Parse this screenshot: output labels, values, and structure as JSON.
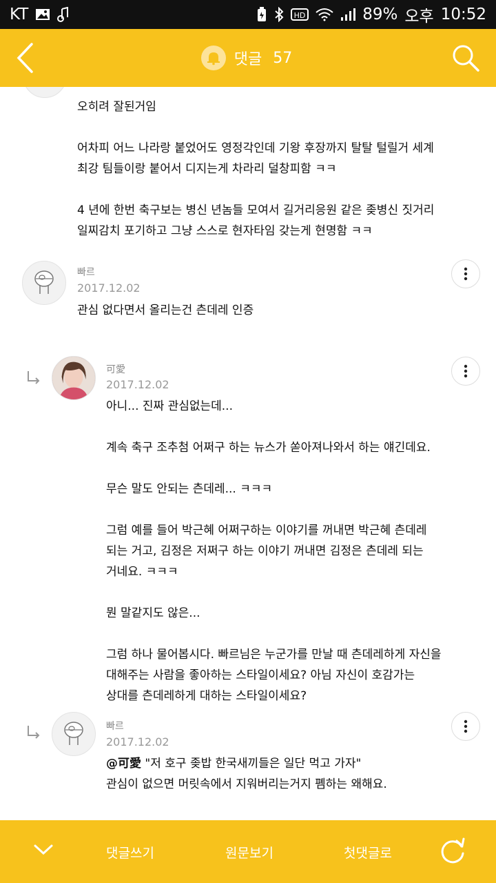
{
  "status_bar": {
    "carrier": "KT",
    "battery": "89%",
    "ampm": "오후",
    "time": "10:52",
    "icons": [
      "image-icon",
      "music-icon",
      "battery-saver-icon",
      "bluetooth-icon",
      "hd-icon",
      "wifi-icon",
      "signal-icon"
    ]
  },
  "header": {
    "back_icon": "back-chevron-icon",
    "bell_icon": "bell-icon",
    "title": "댓글",
    "count": "57",
    "search_icon": "search-icon"
  },
  "comments": [
    {
      "author": "",
      "date": "",
      "body": "오히려 잘된거임\n\n어차피 어느 나라랑 붙었어도 영정각인데 기왕 후장까지 탈탈 털릴거 세계\n최강 팀들이랑 붙어서 디지는게 차라리 덜창피함 ㅋㅋ\n\n4 년에 한번 축구보는 병신 년놈들 모여서 길거리응원 같은 좆병신 짓거리\n일찌감치 포기하고 그냥 스스로 현자타임 갖는게 현명함 ㅋㅋ"
    },
    {
      "author": "빠르",
      "date": "2017.12.02",
      "body": "관심 없다면서 올리는건 츤데레 인증"
    },
    {
      "author": "可愛",
      "date": "2017.12.02",
      "body": "아니... 진짜 관심없는데...\n\n계속 축구 조추첨 어쩌구 하는 뉴스가 쏟아져나와서 하는 얘긴데요.\n\n무슨 말도 안되는 츤데레... ㅋㅋㅋ\n\n그럼 예를 들어 박근혜 어쩌구하는 이야기를 꺼내면 박근혜 츤데레\n되는 거고, 김정은 저쩌구 하는 이야기 꺼내면 김정은 츤데레 되는\n거네요. ㅋㅋㅋ\n\n뭔 말같지도 않은...\n\n그럼 하나 물어봅시다. 빠르님은 누군가를 만날 때 츤데레하게 자신을\n대해주는 사람을 좋아하는 스타일이세요? 아님 자신이 호감가는\n상대를 츤데레하게 대하는 스타일이세요?"
    },
    {
      "author": "빠르",
      "date": "2017.12.02",
      "mention": "@可愛",
      "body_first": " \"저 호구 좆밥 한국새끼들은 일단 먹고 가자\"",
      "body_rest": "관심이 없으면 머릿속에서 지워버리는거지 폠하는 왜해요."
    }
  ],
  "footer": {
    "collapse_icon": "chevron-down-icon",
    "write": "댓글쓰기",
    "original": "원문보기",
    "first": "첫댓글로",
    "refresh_icon": "refresh-icon"
  },
  "colors": {
    "accent": "#f7c21c",
    "statusbar": "#111111"
  }
}
